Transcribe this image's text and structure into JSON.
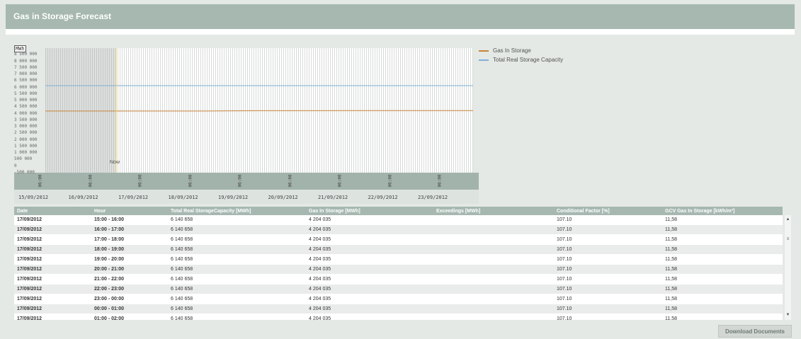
{
  "header": {
    "title": "Gas in Storage Forecast"
  },
  "chart_data": {
    "type": "line",
    "ylabel": "MWh",
    "ylim": [
      -500000,
      9000000
    ],
    "yticks": [
      "8 500 000",
      "8 000 000",
      "7 500 000",
      "7 000 000",
      "6 500 000",
      "6 000 000",
      "5 500 000",
      "5 000 000",
      "4 500 000",
      "4 000 000",
      "3 500 000",
      "3 000 000",
      "2 500 000",
      "2 000 000",
      "1 500 000",
      "1 000 000",
      "500 000",
      "0",
      "-500 000"
    ],
    "x_time_labels": [
      "06:00",
      "06:00",
      "06:00",
      "06:00",
      "06:00",
      "06:00",
      "06:00",
      "06:00",
      "06:00"
    ],
    "x_date_labels": [
      "15/09/2012",
      "16/09/2012",
      "17/09/2012",
      "18/09/2012",
      "19/09/2012",
      "20/09/2012",
      "21/09/2012",
      "22/09/2012",
      "23/09/2012"
    ],
    "now_label": "Now",
    "series": [
      {
        "name": "Gas In Storage",
        "color": "#c8843a",
        "values": [
          4204035,
          4204035,
          4204035,
          4204035,
          4230000,
          4230000,
          4240000,
          4240000,
          4240000
        ]
      },
      {
        "name": "Total Real Storage Capacity",
        "color": "#7fb0d8",
        "values": [
          6140658,
          6140658,
          6140658,
          6140658,
          6140658,
          6140658,
          6140658,
          6140658,
          6140658
        ]
      }
    ]
  },
  "table": {
    "headers": [
      "Date",
      "Hour",
      "Total Real StorageCapacity [MWh]",
      "Gas In Storage [MWh]",
      "Exceedings [MWh]",
      "Conditional Factor [%]",
      "GCV Gas In Storage [kWh/m³]"
    ],
    "rows": [
      [
        "17/09/2012",
        "15:00 - 16:00",
        "6 140 658",
        "4 204 035",
        "",
        "107.10",
        "11,58"
      ],
      [
        "17/09/2012",
        "16:00 - 17:00",
        "6 140 658",
        "4 204 035",
        "",
        "107.10",
        "11,58"
      ],
      [
        "17/09/2012",
        "17:00 - 18:00",
        "6 140 658",
        "4 204 035",
        "",
        "107.10",
        "11,58"
      ],
      [
        "17/09/2012",
        "18:00 - 19:00",
        "6 140 658",
        "4 204 035",
        "",
        "107.10",
        "11,58"
      ],
      [
        "17/09/2012",
        "19:00 - 20:00",
        "6 140 658",
        "4 204 035",
        "",
        "107.10",
        "11,58"
      ],
      [
        "17/09/2012",
        "20:00 - 21:00",
        "6 140 658",
        "4 204 035",
        "",
        "107.10",
        "11,58"
      ],
      [
        "17/09/2012",
        "21:00 - 22:00",
        "6 140 658",
        "4 204 035",
        "",
        "107.10",
        "11,58"
      ],
      [
        "17/09/2012",
        "22:00 - 23:00",
        "6 140 658",
        "4 204 035",
        "",
        "107.10",
        "11,58"
      ],
      [
        "17/09/2012",
        "23:00 - 00:00",
        "6 140 658",
        "4 204 035",
        "",
        "107.10",
        "11,58"
      ],
      [
        "17/09/2012",
        "00:00 - 01:00",
        "6 140 658",
        "4 204 035",
        "",
        "107.10",
        "11,58"
      ],
      [
        "17/09/2012",
        "01:00 - 02:00",
        "6 140 658",
        "4 204 035",
        "",
        "107.10",
        "11,58"
      ]
    ]
  },
  "scrollbar": {
    "up": "▲",
    "down": "▼",
    "grip": "≡"
  },
  "footer": {
    "download_label": "Download Documents"
  }
}
